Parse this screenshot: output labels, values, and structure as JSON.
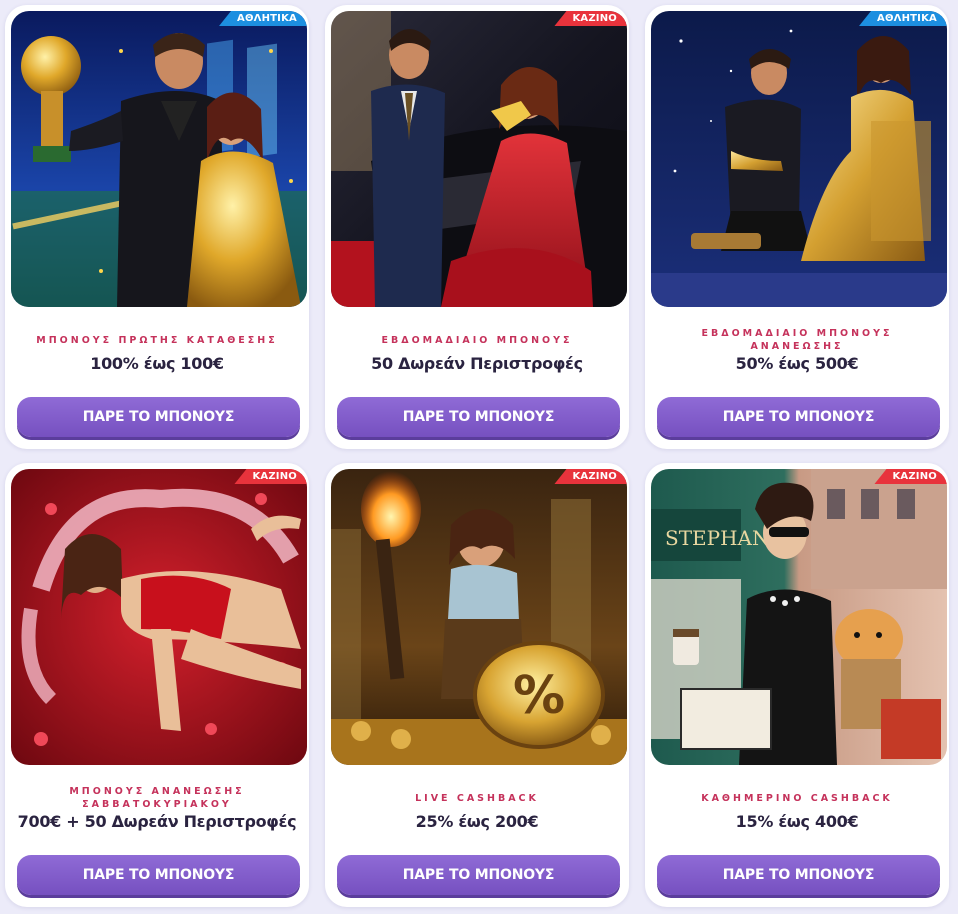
{
  "accent_colors": {
    "page_background": "#ecebf9",
    "button": "#7d57c6",
    "subtitle": "#c5325b",
    "tag_sports": "#1d8fe0",
    "tag_casino": "#e8333c",
    "offer_text": "#2a2340"
  },
  "cards": [
    {
      "tag": "ΑΘΛΗΤΙΚΑ",
      "tag_type": "sports",
      "image": "trophy-couple-stadium",
      "subtitle": "ΜΠΟΝΟΥΣ ΠΡΩΤΗΣ ΚΑΤΑΘΕΣΗΣ",
      "offer": "100% έως 100€",
      "button": "ΠΑΡΕ ΤΟ ΜΠΟΝΟΥΣ"
    },
    {
      "tag": "ΚΑΖΙΝΟ",
      "tag_type": "casino",
      "image": "red-dress-limousine",
      "subtitle": "ΕΒΔΟΜΑΔΙΑΙΟ ΜΠΟΝΟΥΣ",
      "offer": "50 Δωρεάν Περιστροφές",
      "button": "ΠΑΡΕ ΤΟ ΜΠΟΝΟΥΣ"
    },
    {
      "tag": "ΑΘΛΗΤΙΚΑ",
      "tag_type": "sports",
      "image": "golden-boot-night",
      "subtitle": "ΕΒΔΟΜΑΔΙΑΙΟ ΜΠΟΝΟΥΣ ΑΝΑΝΕΩΣΗΣ",
      "offer": "50% έως 500€",
      "button": "ΠΑΡΕ ΤΟ ΜΠΟΝΟΥΣ"
    },
    {
      "tag": "ΚΑΖΙΝΟ",
      "tag_type": "casino",
      "image": "rose-petals",
      "subtitle": "ΜΠΟΝΟΥΣ ΑΝΑΝΕΩΣΗΣ ΣΑΒΒΑΤΟΚΥΡΙΑΚΟΥ",
      "offer": "700€ + 50 Δωρεάν Περιστροφές",
      "button": "ΠΑΡΕ ΤΟ ΜΠΟΝΟΥΣ"
    },
    {
      "tag": "ΚΑΖΙΝΟ",
      "tag_type": "casino",
      "image": "explorer-percent-coin",
      "subtitle": "LIVE CASHBACK",
      "offer": "25% έως 200€",
      "button": "ΠΑΡΕ ΤΟ ΜΠΟΝΟΥΣ"
    },
    {
      "tag": "ΚΑΖΙΝΟ",
      "tag_type": "casino",
      "image": "shopping-lady-dog",
      "subtitle": "ΚΑΘΗΜΕΡΙΝΟ CASHBACK",
      "offer": "15% έως 400€",
      "button": "ΠΑΡΕ ΤΟ ΜΠΟΝΟΥΣ"
    }
  ],
  "storefront_sign": "STEPHAN"
}
